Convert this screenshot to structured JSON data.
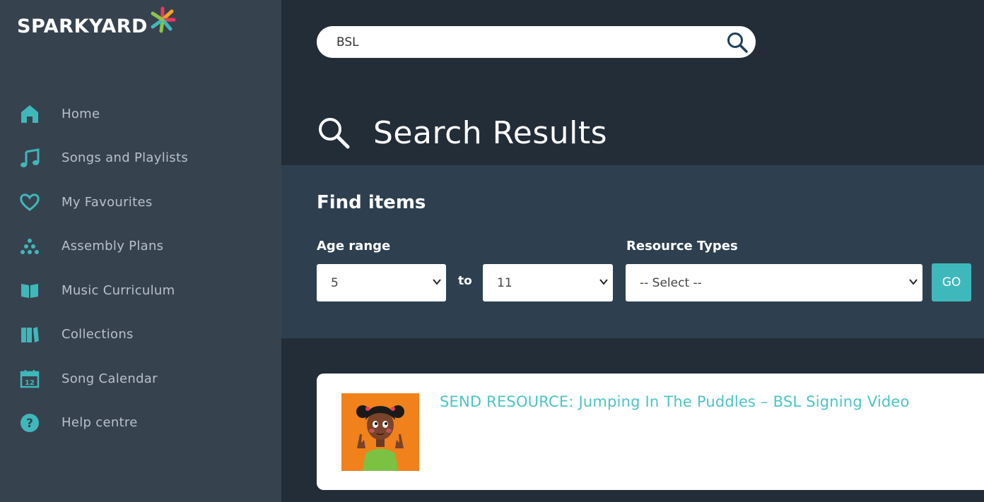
{
  "brand": {
    "logo_text": "SPARKYARD"
  },
  "sidebar": {
    "items": [
      {
        "label": "Home",
        "icon": "home-icon"
      },
      {
        "label": "Songs and Playlists",
        "icon": "music-note-icon"
      },
      {
        "label": "My Favourites",
        "icon": "heart-icon"
      },
      {
        "label": "Assembly Plans",
        "icon": "dots-pyramid-icon"
      },
      {
        "label": "Music Curriculum",
        "icon": "open-book-icon"
      },
      {
        "label": "Collections",
        "icon": "books-icon"
      },
      {
        "label": "Song Calendar",
        "icon": "calendar-icon"
      },
      {
        "label": "Help centre",
        "icon": "question-icon"
      }
    ]
  },
  "search": {
    "value": "BSL"
  },
  "results": {
    "title": "Search Results"
  },
  "filters": {
    "title": "Find items",
    "age_label": "Age range",
    "age_from": "5",
    "to_label": "to",
    "age_to": "11",
    "resource_label": "Resource Types",
    "resource_value": "-- Select --",
    "go_label": "GO"
  },
  "result_items": [
    {
      "title": "SEND RESOURCE: Jumping In The Puddles – BSL Signing Video"
    }
  ],
  "colors": {
    "accent": "#3fb8bb",
    "sidebar_bg": "#37424f",
    "main_bg": "#232d38",
    "panel_bg": "#2e404f",
    "link": "#4dc3c5"
  }
}
